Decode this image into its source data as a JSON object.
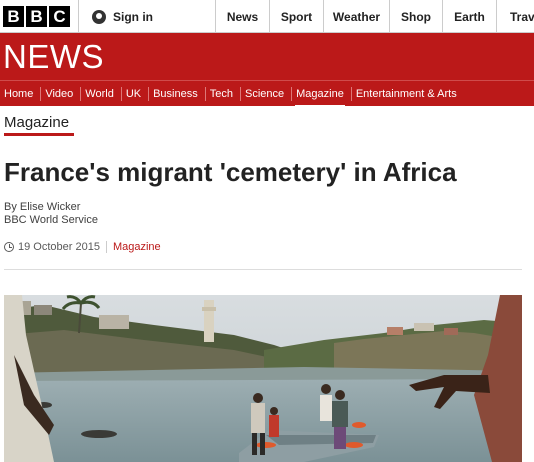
{
  "brand": {
    "letters": [
      "B",
      "B",
      "C"
    ]
  },
  "header": {
    "signin_label": "Sign in",
    "nav": [
      "News",
      "Sport",
      "Weather",
      "Shop",
      "Earth",
      "Travel"
    ]
  },
  "banner": {
    "title": "NEWS"
  },
  "section_nav": {
    "items": [
      "Home",
      "Video",
      "World",
      "UK",
      "Business",
      "Tech",
      "Science",
      "Magazine",
      "Entertainment & Arts"
    ],
    "active": "Magazine"
  },
  "article": {
    "section": "Magazine",
    "headline": "France's migrant 'cemetery' in Africa",
    "author": "By Elise Wicker",
    "author_role": "BBC World Service",
    "date": "19 October 2015",
    "category": "Magazine"
  },
  "colors": {
    "brand_red": "#bb1919",
    "text": "#222222"
  }
}
